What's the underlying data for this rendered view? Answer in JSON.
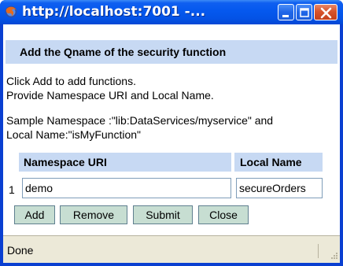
{
  "window": {
    "title": "http://localhost:7001 -..."
  },
  "dialog": {
    "heading": "Add the Qname of the security function",
    "instructions_line1": "Click Add to add functions.",
    "instructions_line2": "Provide Namespace URI and Local Name.",
    "sample_line1": "Sample Namespace :\"lib:DataServices/myservice\" and",
    "sample_line2": "Local Name:\"isMyFunction\""
  },
  "table": {
    "columns": [
      "Namespace URI",
      "Local Name"
    ],
    "rows": [
      {
        "index": "1",
        "namespace_uri": "demo",
        "local_name": "secureOrders"
      }
    ]
  },
  "buttons": {
    "add": "Add",
    "remove": "Remove",
    "submit": "Submit",
    "close": "Close"
  },
  "status": {
    "text": "Done"
  },
  "colors": {
    "title_bar": "#0558ee",
    "header_band": "#c7d9f3",
    "button_bg": "#c7ded2",
    "status_bar": "#ece9d8"
  }
}
